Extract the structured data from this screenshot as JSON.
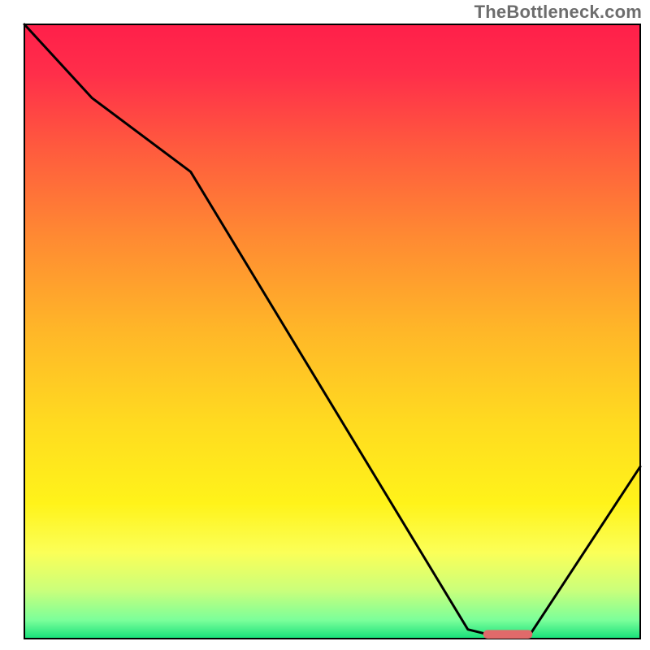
{
  "watermark": "TheBottleneck.com",
  "chart_data": {
    "type": "line",
    "title": "",
    "xlabel": "",
    "ylabel": "",
    "xlim": [
      0,
      100
    ],
    "ylim": [
      0,
      100
    ],
    "grid": false,
    "legend": false,
    "background": {
      "type": "vertical-gradient",
      "stops": [
        {
          "offset": 0.0,
          "color": "#ff1f4a"
        },
        {
          "offset": 0.08,
          "color": "#ff2e4a"
        },
        {
          "offset": 0.2,
          "color": "#ff5a3e"
        },
        {
          "offset": 0.35,
          "color": "#ff8b32"
        },
        {
          "offset": 0.5,
          "color": "#ffb728"
        },
        {
          "offset": 0.65,
          "color": "#ffdb20"
        },
        {
          "offset": 0.78,
          "color": "#fff31a"
        },
        {
          "offset": 0.86,
          "color": "#fbff58"
        },
        {
          "offset": 0.92,
          "color": "#ccff7a"
        },
        {
          "offset": 0.97,
          "color": "#7bff9a"
        },
        {
          "offset": 1.0,
          "color": "#16e07a"
        }
      ]
    },
    "series": [
      {
        "name": "bottleneck-curve",
        "color": "#000000",
        "x": [
          0,
          11,
          27,
          72,
          76,
          82,
          100
        ],
        "values": [
          100,
          88,
          76,
          1.5,
          0.5,
          0.5,
          28
        ]
      }
    ],
    "marker": {
      "name": "optimum-range",
      "color": "#e06a6a",
      "x_start": 74.5,
      "x_end": 82.5,
      "y": 0.7,
      "thickness_pct": 1.4
    },
    "inner_frame": true
  }
}
